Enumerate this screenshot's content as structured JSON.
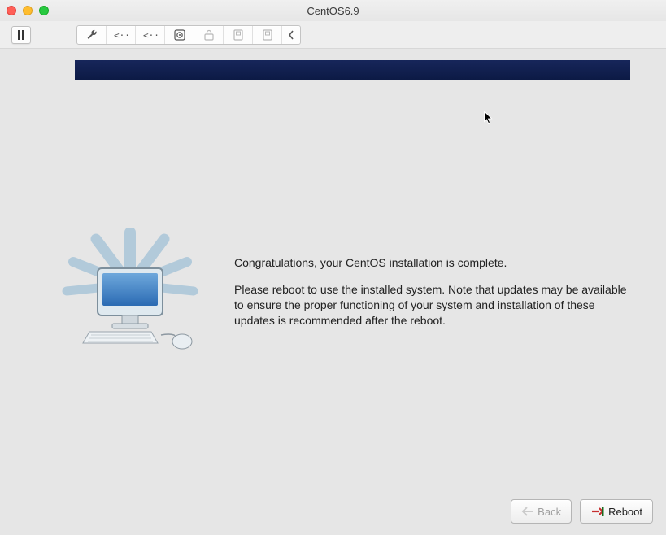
{
  "window": {
    "title": "CentOS6.9"
  },
  "toolbar": {
    "icons": {
      "pause": "pause-icon",
      "wrench": "wrench-icon",
      "net1": "network-icon",
      "net2": "network-icon",
      "disk": "disk-icon",
      "lock": "lock-icon",
      "fd1": "device-icon",
      "fd2": "device-icon",
      "more": "chevron-left-icon"
    }
  },
  "installer": {
    "heading": "Congratulations, your CentOS installation is complete.",
    "body": "Please reboot to use the installed system.  Note that updates may be available to ensure the proper functioning of your system and installation of these updates is recommended after the reboot.",
    "back_label": "Back",
    "reboot_label": "Reboot"
  }
}
